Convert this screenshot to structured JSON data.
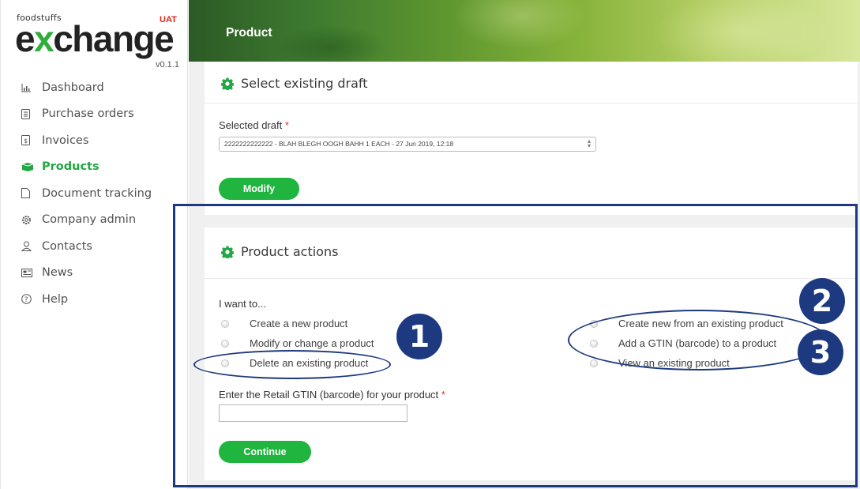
{
  "logo": {
    "small_text": "foodstuffs",
    "env_badge": "UAT",
    "wordmark_prefix": "e",
    "wordmark_x": "x",
    "wordmark_rest": "change",
    "version": "v0.1.1"
  },
  "sidebar": {
    "items": [
      {
        "label": "Dashboard",
        "icon": "bar-chart-icon",
        "active": false
      },
      {
        "label": "Purchase orders",
        "icon": "document-icon",
        "active": false
      },
      {
        "label": "Invoices",
        "icon": "invoice-icon",
        "active": false
      },
      {
        "label": "Products",
        "icon": "box-icon",
        "active": true
      },
      {
        "label": "Document tracking",
        "icon": "file-icon",
        "active": false
      },
      {
        "label": "Company admin",
        "icon": "gear-icon",
        "active": false
      },
      {
        "label": "Contacts",
        "icon": "user-icon",
        "active": false
      },
      {
        "label": "News",
        "icon": "newspaper-icon",
        "active": false
      },
      {
        "label": "Help",
        "icon": "question-icon",
        "active": false
      }
    ]
  },
  "header": {
    "title": "Product"
  },
  "draft_card": {
    "title": "Select existing draft",
    "field_label": "Selected draft",
    "required_mark": "*",
    "selected_value": "2222222222222 - BLAH BLEGH OOGH BAHH 1 EACH - 27 Jun 2019, 12:18",
    "modify_label": "Modify"
  },
  "actions_card": {
    "title": "Product actions",
    "prompt": "I want to...",
    "left_options": [
      "Create a new product",
      "Modify or change a product",
      "Delete an existing product"
    ],
    "right_options": [
      "Create new from an existing product",
      "Add a GTIN (barcode) to a product",
      "View an existing product"
    ],
    "gtin_label": "Enter the Retail GTIN (barcode) for your product",
    "required_mark": "*",
    "gtin_value": "",
    "continue_label": "Continue"
  },
  "annotations": {
    "badge_1": "1",
    "badge_2": "2",
    "badge_3": "3",
    "color": "#1d3a80"
  },
  "colors": {
    "accent_green": "#1fb53e",
    "active_nav": "#22a744",
    "required": "#e0312b"
  }
}
